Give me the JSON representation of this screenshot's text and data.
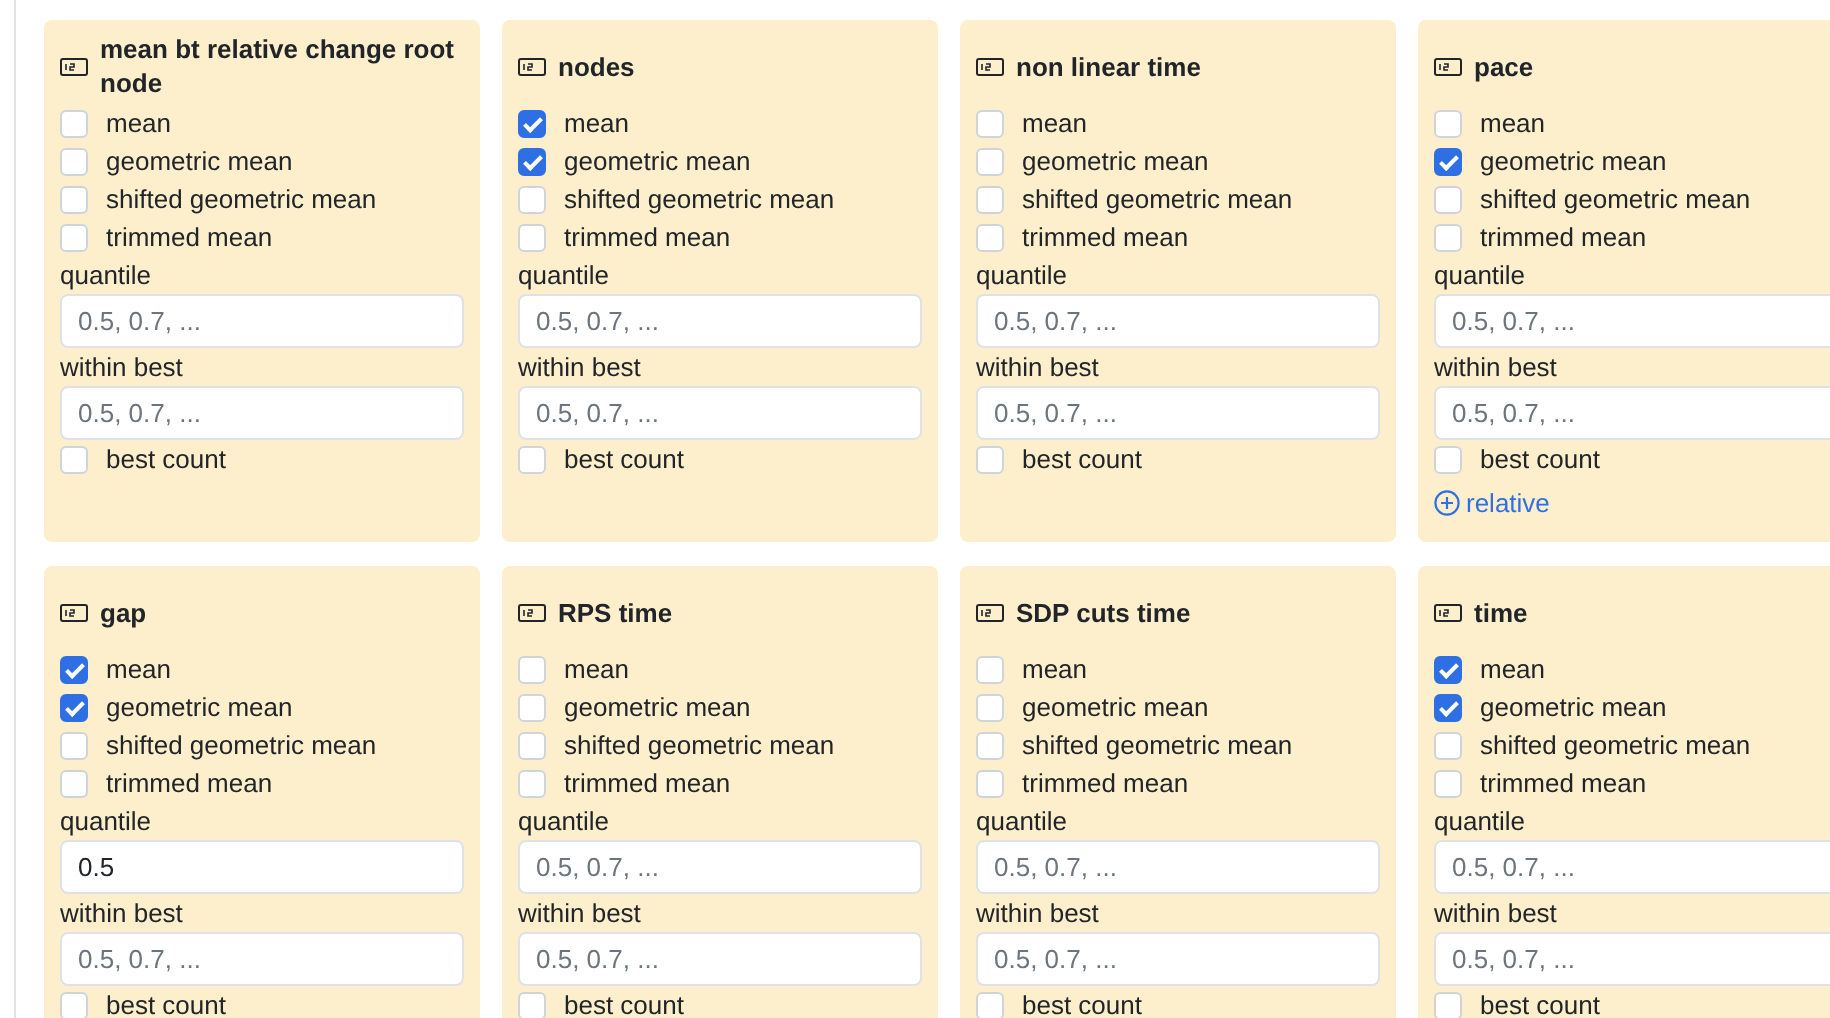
{
  "cards": [
    {
      "title": "mean bt relative change root node",
      "stats": [
        {
          "label": "mean",
          "checked": false
        },
        {
          "label": "geometric mean",
          "checked": false
        },
        {
          "label": "shifted geometric mean",
          "checked": false
        },
        {
          "label": "trimmed mean",
          "checked": false
        }
      ],
      "quantile": {
        "label": "quantile",
        "placeholder": "0.5, 0.7, ..."
      },
      "within_best": {
        "label": "within best",
        "placeholder": "0.5, 0.7, ..."
      },
      "best_count": {
        "label": "best count",
        "checked": false
      }
    },
    {
      "title": "nodes",
      "stats": [
        {
          "label": "mean",
          "checked": true
        },
        {
          "label": "geometric mean",
          "checked": true
        },
        {
          "label": "shifted geometric mean",
          "checked": false
        },
        {
          "label": "trimmed mean",
          "checked": false
        }
      ],
      "quantile": {
        "label": "quantile",
        "placeholder": "0.5, 0.7, ..."
      },
      "within_best": {
        "label": "within best",
        "placeholder": "0.5, 0.7, ..."
      },
      "best_count": {
        "label": "best count",
        "checked": false
      }
    },
    {
      "title": "non linear time",
      "stats": [
        {
          "label": "mean",
          "checked": false
        },
        {
          "label": "geometric mean",
          "checked": false
        },
        {
          "label": "shifted geometric mean",
          "checked": false
        },
        {
          "label": "trimmed mean",
          "checked": false
        }
      ],
      "quantile": {
        "label": "quantile",
        "placeholder": "0.5, 0.7, ..."
      },
      "within_best": {
        "label": "within best",
        "placeholder": "0.5, 0.7, ..."
      },
      "best_count": {
        "label": "best count",
        "checked": false
      }
    },
    {
      "title": "pace",
      "stats": [
        {
          "label": "mean",
          "checked": false
        },
        {
          "label": "geometric mean",
          "checked": true
        },
        {
          "label": "shifted geometric mean",
          "checked": false
        },
        {
          "label": "trimmed mean",
          "checked": false
        }
      ],
      "quantile": {
        "label": "quantile",
        "placeholder": "0.5, 0.7, ..."
      },
      "within_best": {
        "label": "within best",
        "placeholder": "0.5, 0.7, ..."
      },
      "best_count": {
        "label": "best count",
        "checked": false
      },
      "link": "relative"
    },
    {
      "title": "gap",
      "stats": [
        {
          "label": "mean",
          "checked": true
        },
        {
          "label": "geometric mean",
          "checked": true
        },
        {
          "label": "shifted geometric mean",
          "checked": false
        },
        {
          "label": "trimmed mean",
          "checked": false
        }
      ],
      "quantile": {
        "label": "quantile",
        "value": "0.5"
      },
      "within_best": {
        "label": "within best",
        "placeholder": "0.5, 0.7, ..."
      },
      "best_count": {
        "label": "best count",
        "checked": false
      }
    },
    {
      "title": "RPS time",
      "stats": [
        {
          "label": "mean",
          "checked": false
        },
        {
          "label": "geometric mean",
          "checked": false
        },
        {
          "label": "shifted geometric mean",
          "checked": false
        },
        {
          "label": "trimmed mean",
          "checked": false
        }
      ],
      "quantile": {
        "label": "quantile",
        "placeholder": "0.5, 0.7, ..."
      },
      "within_best": {
        "label": "within best",
        "placeholder": "0.5, 0.7, ..."
      },
      "best_count": {
        "label": "best count",
        "checked": false
      }
    },
    {
      "title": "SDP cuts time",
      "stats": [
        {
          "label": "mean",
          "checked": false
        },
        {
          "label": "geometric mean",
          "checked": false
        },
        {
          "label": "shifted geometric mean",
          "checked": false
        },
        {
          "label": "trimmed mean",
          "checked": false
        }
      ],
      "quantile": {
        "label": "quantile",
        "placeholder": "0.5, 0.7, ..."
      },
      "within_best": {
        "label": "within best",
        "placeholder": "0.5, 0.7, ..."
      },
      "best_count": {
        "label": "best count",
        "checked": false
      }
    },
    {
      "title": "time",
      "stats": [
        {
          "label": "mean",
          "checked": true
        },
        {
          "label": "geometric mean",
          "checked": true
        },
        {
          "label": "shifted geometric mean",
          "checked": false
        },
        {
          "label": "trimmed mean",
          "checked": false
        }
      ],
      "quantile": {
        "label": "quantile",
        "placeholder": "0.5, 0.7, ..."
      },
      "within_best": {
        "label": "within best",
        "placeholder": "0.5, 0.7, ..."
      },
      "best_count": {
        "label": "best count",
        "checked": false
      }
    }
  ]
}
